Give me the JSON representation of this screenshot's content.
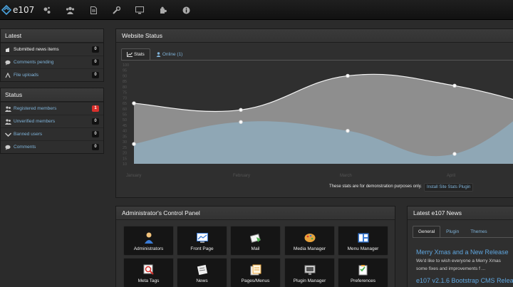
{
  "brand": {
    "name": "e107"
  },
  "navbar": {
    "icons": [
      "network-icon",
      "users-icon",
      "document-icon",
      "wrench-icon",
      "monitor-icon",
      "puzzle-icon",
      "info-icon"
    ]
  },
  "sidebar": {
    "latest": {
      "title": "Latest",
      "items": [
        {
          "label": "Submitted news items",
          "count": "0",
          "icon": "news-icon"
        },
        {
          "label": "Comments pending",
          "count": "0",
          "icon": "comment-icon"
        },
        {
          "label": "File uploads",
          "count": "0",
          "icon": "upload-icon"
        }
      ]
    },
    "status": {
      "title": "Status",
      "items": [
        {
          "label": "Registered members",
          "count": "1",
          "icon": "members-icon"
        },
        {
          "label": "Unverified members",
          "count": "0",
          "icon": "members-icon"
        },
        {
          "label": "Banned users",
          "count": "0",
          "icon": "banned-icon"
        },
        {
          "label": "Comments",
          "count": "0",
          "icon": "comment-icon"
        }
      ]
    }
  },
  "website_status": {
    "title": "Website Status",
    "tabs": [
      "Stats",
      "Online (1)"
    ],
    "note": "These stats are for demonstration purposes only.",
    "install_button": "Install Site Stats Plugin"
  },
  "chart_data": {
    "type": "area",
    "x": [
      "January",
      "February",
      "March",
      "April"
    ],
    "y_ticks": [
      100,
      95,
      90,
      85,
      80,
      75,
      70,
      65,
      60,
      55,
      50,
      45,
      40,
      35,
      30,
      25,
      20,
      15,
      10
    ],
    "ylim": [
      10,
      100
    ],
    "series": [
      {
        "values": [
          65,
          59,
          90,
          81,
          56
        ],
        "color": "#8e8e8e"
      },
      {
        "values": [
          28,
          48,
          40,
          19,
          86
        ],
        "color": "#8fa7b5"
      }
    ]
  },
  "control_panel": {
    "title": "Administrator's Control Panel",
    "tiles": [
      {
        "label": "Administrators",
        "icon": "administrators-icon"
      },
      {
        "label": "Front Page",
        "icon": "front-page-icon"
      },
      {
        "label": "Mail",
        "icon": "mail-icon"
      },
      {
        "label": "Media Manager",
        "icon": "media-manager-icon"
      },
      {
        "label": "Menu Manager",
        "icon": "menu-manager-icon"
      },
      {
        "label": "Meta Tags",
        "icon": "meta-tags-icon"
      },
      {
        "label": "News",
        "icon": "news-icon"
      },
      {
        "label": "Pages/Menus",
        "icon": "pages-menus-icon"
      },
      {
        "label": "Plugin Manager",
        "icon": "plugin-manager-icon"
      },
      {
        "label": "Preferences",
        "icon": "preferences-icon"
      }
    ]
  },
  "latest_news": {
    "title": "Latest e107 News",
    "tabs": [
      "General",
      "Plugin",
      "Themes"
    ],
    "items": [
      {
        "title": "Merry Xmas and a New Release",
        "line1": "We'd like to wish everyone a Merry Xmas",
        "line2": "some fixes and improvements f ..."
      },
      {
        "title": "e107 v2.1.6 Bootstrap CMS Release"
      }
    ]
  }
}
